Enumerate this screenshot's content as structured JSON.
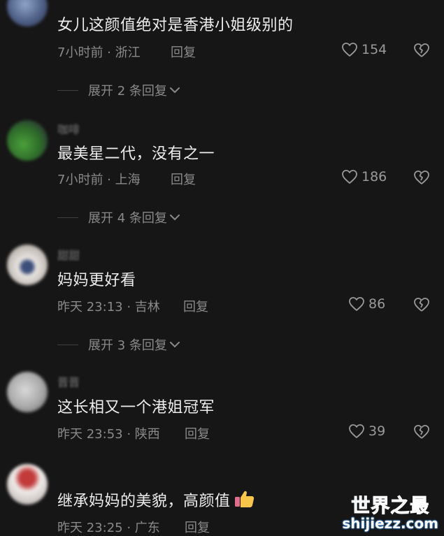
{
  "comments": [
    {
      "username": "",
      "text": "女儿这颜值绝对是香港小姐级别的",
      "meta": "7小时前 · 浙江",
      "reply_label": "回复",
      "likes": "154",
      "expand_label": "展开 2 条回复"
    },
    {
      "username": "咖啡",
      "text": "最美星二代，没有之一",
      "meta": "7小时前 · 上海",
      "reply_label": "回复",
      "likes": "186",
      "expand_label": "展开 4 条回复"
    },
    {
      "username": "甜甜",
      "text": "妈妈更好看",
      "meta": "昨天 23:13 · 吉林",
      "reply_label": "回复",
      "likes": "86",
      "expand_label": "展开 3 条回复"
    },
    {
      "username": "晋晋",
      "text": "这长相又一个港姐冠军",
      "meta": "昨天 23:53 · 陕西",
      "reply_label": "回复",
      "likes": "39"
    },
    {
      "username": "",
      "text": "继承妈妈的美貌，高颜值",
      "meta": "昨天 23:25 · 广东",
      "reply_label": "回复",
      "emoji": "thumbs-up"
    }
  ],
  "watermark": {
    "title": "世界之最",
    "subtitle": "shijiezz.com"
  },
  "colors": {
    "background": "#161616",
    "text": "#ededed",
    "muted": "#8a8a8a",
    "watermark": "#3b8ee8"
  }
}
